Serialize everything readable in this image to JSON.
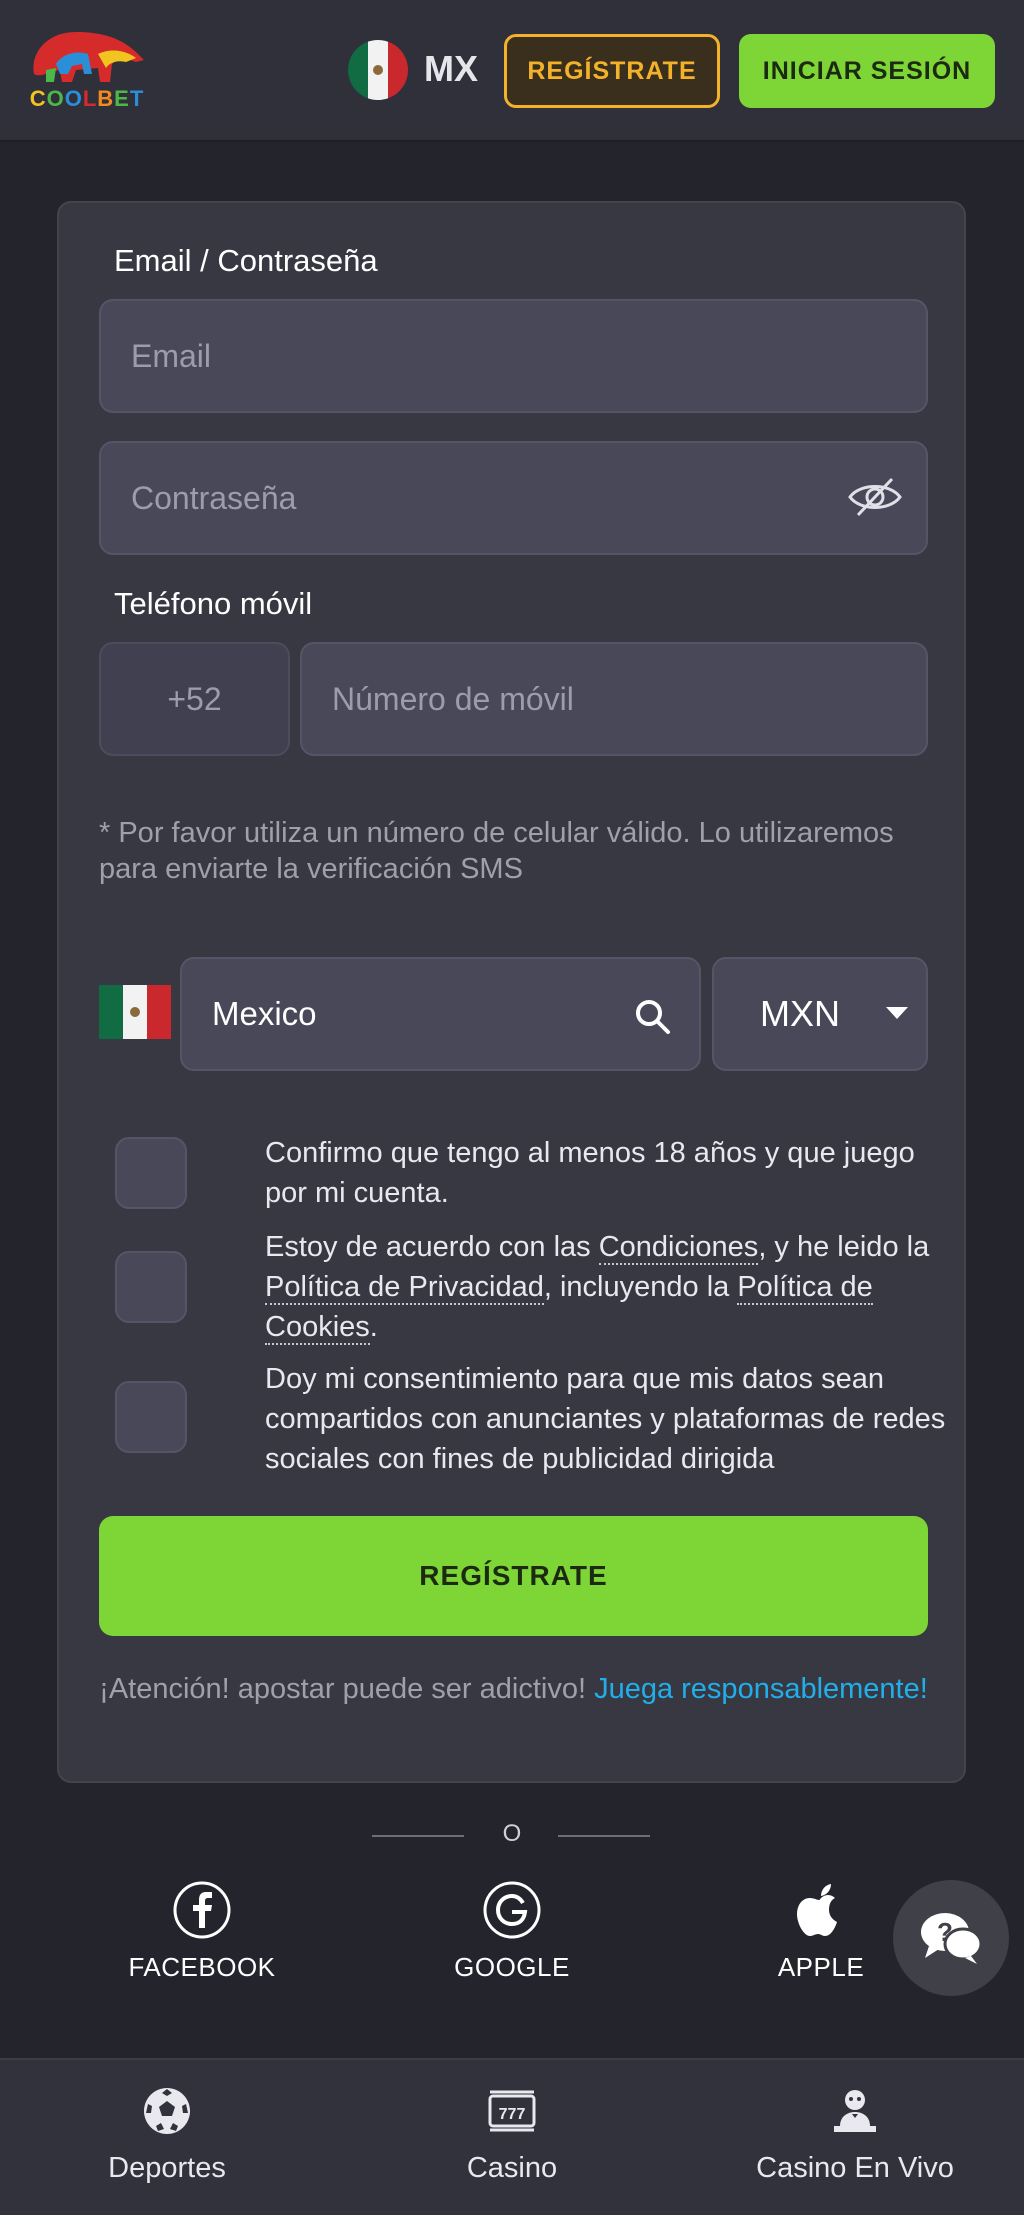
{
  "header": {
    "logo_text": "COOLBET",
    "country_code": "MX",
    "register_label": "REGÍSTRATE",
    "login_label": "INICIAR SESIÓN"
  },
  "form": {
    "email_section_label": "Email / Contraseña",
    "email_placeholder": "Email",
    "password_placeholder": "Contraseña",
    "phone_section_label": "Teléfono móvil",
    "phone_prefix": "+52",
    "phone_placeholder": "Número de móvil",
    "phone_hint": "* Por favor utiliza un número de celular válido. Lo utilizaremos para enviarte la verificación SMS",
    "country_value": "Mexico",
    "currency_value": "MXN",
    "checks": {
      "age": "Confirmo que tengo al menos 18 años y que juego por mi cuenta.",
      "terms_a": "Estoy de acuerdo con las ",
      "terms_link1": "Condiciones",
      "terms_b": ", y he leido la ",
      "terms_link2": "Política de Privacidad",
      "terms_c": ", incluyendo la ",
      "terms_link3": "Política de Cookies",
      "terms_d": ".",
      "consent": "Doy mi consentimiento para que mis datos sean compartidos con anunciantes y plataformas de redes sociales con fines de publicidad dirigida"
    },
    "submit_label": "REGÍSTRATE",
    "warning_text": "¡Atención! apostar puede ser adictivo! ",
    "warning_link": "Juega responsablemente!"
  },
  "divider_text": "O",
  "social": {
    "facebook": "FACEBOOK",
    "google": "GOOGLE",
    "apple": "APPLE"
  },
  "bottom_nav": {
    "sports": "Deportes",
    "casino": "Casino",
    "live_casino": "Casino En Vivo"
  },
  "colors": {
    "accent_green": "#7ed636",
    "accent_orange": "#f3b22a",
    "link_blue": "#22aee8"
  }
}
